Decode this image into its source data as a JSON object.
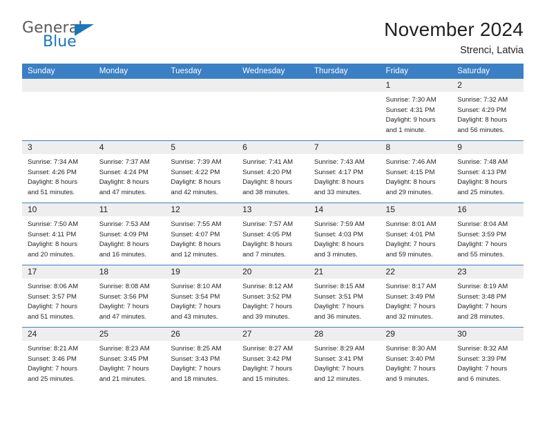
{
  "logo": {
    "word_one": "General",
    "word_two": "Blue",
    "triangle_icon": "triangle-icon",
    "accent_color": "#1b75bb",
    "gray_color": "#58595b"
  },
  "header": {
    "title": "November 2024",
    "location": "Strenci, Latvia"
  },
  "theme": {
    "header_blue": "#3b7fc4",
    "date_band_gray": "#eeeeee",
    "text": "#231f20"
  },
  "calendar": {
    "weekday_headers": [
      "Sunday",
      "Monday",
      "Tuesday",
      "Wednesday",
      "Thursday",
      "Friday",
      "Saturday"
    ],
    "weeks": [
      [
        {
          "day": "",
          "sunrise": "",
          "sunset": "",
          "daylight_1": "",
          "daylight_2": ""
        },
        {
          "day": "",
          "sunrise": "",
          "sunset": "",
          "daylight_1": "",
          "daylight_2": ""
        },
        {
          "day": "",
          "sunrise": "",
          "sunset": "",
          "daylight_1": "",
          "daylight_2": ""
        },
        {
          "day": "",
          "sunrise": "",
          "sunset": "",
          "daylight_1": "",
          "daylight_2": ""
        },
        {
          "day": "",
          "sunrise": "",
          "sunset": "",
          "daylight_1": "",
          "daylight_2": ""
        },
        {
          "day": "1",
          "sunrise": "Sunrise: 7:30 AM",
          "sunset": "Sunset: 4:31 PM",
          "daylight_1": "Daylight: 9 hours",
          "daylight_2": "and 1 minute."
        },
        {
          "day": "2",
          "sunrise": "Sunrise: 7:32 AM",
          "sunset": "Sunset: 4:29 PM",
          "daylight_1": "Daylight: 8 hours",
          "daylight_2": "and 56 minutes."
        }
      ],
      [
        {
          "day": "3",
          "sunrise": "Sunrise: 7:34 AM",
          "sunset": "Sunset: 4:26 PM",
          "daylight_1": "Daylight: 8 hours",
          "daylight_2": "and 51 minutes."
        },
        {
          "day": "4",
          "sunrise": "Sunrise: 7:37 AM",
          "sunset": "Sunset: 4:24 PM",
          "daylight_1": "Daylight: 8 hours",
          "daylight_2": "and 47 minutes."
        },
        {
          "day": "5",
          "sunrise": "Sunrise: 7:39 AM",
          "sunset": "Sunset: 4:22 PM",
          "daylight_1": "Daylight: 8 hours",
          "daylight_2": "and 42 minutes."
        },
        {
          "day": "6",
          "sunrise": "Sunrise: 7:41 AM",
          "sunset": "Sunset: 4:20 PM",
          "daylight_1": "Daylight: 8 hours",
          "daylight_2": "and 38 minutes."
        },
        {
          "day": "7",
          "sunrise": "Sunrise: 7:43 AM",
          "sunset": "Sunset: 4:17 PM",
          "daylight_1": "Daylight: 8 hours",
          "daylight_2": "and 33 minutes."
        },
        {
          "day": "8",
          "sunrise": "Sunrise: 7:46 AM",
          "sunset": "Sunset: 4:15 PM",
          "daylight_1": "Daylight: 8 hours",
          "daylight_2": "and 29 minutes."
        },
        {
          "day": "9",
          "sunrise": "Sunrise: 7:48 AM",
          "sunset": "Sunset: 4:13 PM",
          "daylight_1": "Daylight: 8 hours",
          "daylight_2": "and 25 minutes."
        }
      ],
      [
        {
          "day": "10",
          "sunrise": "Sunrise: 7:50 AM",
          "sunset": "Sunset: 4:11 PM",
          "daylight_1": "Daylight: 8 hours",
          "daylight_2": "and 20 minutes."
        },
        {
          "day": "11",
          "sunrise": "Sunrise: 7:53 AM",
          "sunset": "Sunset: 4:09 PM",
          "daylight_1": "Daylight: 8 hours",
          "daylight_2": "and 16 minutes."
        },
        {
          "day": "12",
          "sunrise": "Sunrise: 7:55 AM",
          "sunset": "Sunset: 4:07 PM",
          "daylight_1": "Daylight: 8 hours",
          "daylight_2": "and 12 minutes."
        },
        {
          "day": "13",
          "sunrise": "Sunrise: 7:57 AM",
          "sunset": "Sunset: 4:05 PM",
          "daylight_1": "Daylight: 8 hours",
          "daylight_2": "and 7 minutes."
        },
        {
          "day": "14",
          "sunrise": "Sunrise: 7:59 AM",
          "sunset": "Sunset: 4:03 PM",
          "daylight_1": "Daylight: 8 hours",
          "daylight_2": "and 3 minutes."
        },
        {
          "day": "15",
          "sunrise": "Sunrise: 8:01 AM",
          "sunset": "Sunset: 4:01 PM",
          "daylight_1": "Daylight: 7 hours",
          "daylight_2": "and 59 minutes."
        },
        {
          "day": "16",
          "sunrise": "Sunrise: 8:04 AM",
          "sunset": "Sunset: 3:59 PM",
          "daylight_1": "Daylight: 7 hours",
          "daylight_2": "and 55 minutes."
        }
      ],
      [
        {
          "day": "17",
          "sunrise": "Sunrise: 8:06 AM",
          "sunset": "Sunset: 3:57 PM",
          "daylight_1": "Daylight: 7 hours",
          "daylight_2": "and 51 minutes."
        },
        {
          "day": "18",
          "sunrise": "Sunrise: 8:08 AM",
          "sunset": "Sunset: 3:56 PM",
          "daylight_1": "Daylight: 7 hours",
          "daylight_2": "and 47 minutes."
        },
        {
          "day": "19",
          "sunrise": "Sunrise: 8:10 AM",
          "sunset": "Sunset: 3:54 PM",
          "daylight_1": "Daylight: 7 hours",
          "daylight_2": "and 43 minutes."
        },
        {
          "day": "20",
          "sunrise": "Sunrise: 8:12 AM",
          "sunset": "Sunset: 3:52 PM",
          "daylight_1": "Daylight: 7 hours",
          "daylight_2": "and 39 minutes."
        },
        {
          "day": "21",
          "sunrise": "Sunrise: 8:15 AM",
          "sunset": "Sunset: 3:51 PM",
          "daylight_1": "Daylight: 7 hours",
          "daylight_2": "and 36 minutes."
        },
        {
          "day": "22",
          "sunrise": "Sunrise: 8:17 AM",
          "sunset": "Sunset: 3:49 PM",
          "daylight_1": "Daylight: 7 hours",
          "daylight_2": "and 32 minutes."
        },
        {
          "day": "23",
          "sunrise": "Sunrise: 8:19 AM",
          "sunset": "Sunset: 3:48 PM",
          "daylight_1": "Daylight: 7 hours",
          "daylight_2": "and 28 minutes."
        }
      ],
      [
        {
          "day": "24",
          "sunrise": "Sunrise: 8:21 AM",
          "sunset": "Sunset: 3:46 PM",
          "daylight_1": "Daylight: 7 hours",
          "daylight_2": "and 25 minutes."
        },
        {
          "day": "25",
          "sunrise": "Sunrise: 8:23 AM",
          "sunset": "Sunset: 3:45 PM",
          "daylight_1": "Daylight: 7 hours",
          "daylight_2": "and 21 minutes."
        },
        {
          "day": "26",
          "sunrise": "Sunrise: 8:25 AM",
          "sunset": "Sunset: 3:43 PM",
          "daylight_1": "Daylight: 7 hours",
          "daylight_2": "and 18 minutes."
        },
        {
          "day": "27",
          "sunrise": "Sunrise: 8:27 AM",
          "sunset": "Sunset: 3:42 PM",
          "daylight_1": "Daylight: 7 hours",
          "daylight_2": "and 15 minutes."
        },
        {
          "day": "28",
          "sunrise": "Sunrise: 8:29 AM",
          "sunset": "Sunset: 3:41 PM",
          "daylight_1": "Daylight: 7 hours",
          "daylight_2": "and 12 minutes."
        },
        {
          "day": "29",
          "sunrise": "Sunrise: 8:30 AM",
          "sunset": "Sunset: 3:40 PM",
          "daylight_1": "Daylight: 7 hours",
          "daylight_2": "and 9 minutes."
        },
        {
          "day": "30",
          "sunrise": "Sunrise: 8:32 AM",
          "sunset": "Sunset: 3:39 PM",
          "daylight_1": "Daylight: 7 hours",
          "daylight_2": "and 6 minutes."
        }
      ]
    ]
  }
}
